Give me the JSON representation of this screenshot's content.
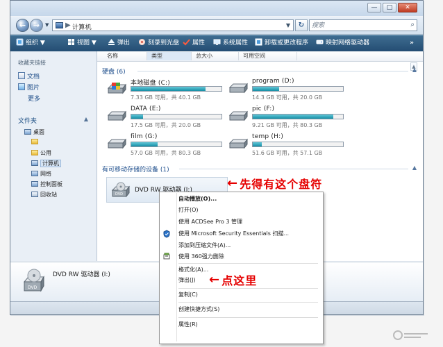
{
  "colors": {
    "toolbar": "#2f5f86",
    "capacity_fill": "#168ea5",
    "annotation": "#e50000",
    "link": "#1e4e8c"
  },
  "window": {
    "controls": {
      "minimize": "—",
      "maximize": "□",
      "close": "✕"
    }
  },
  "address": {
    "path": "计算机",
    "separator": "▶",
    "dropdown": "▼",
    "refresh": "↻"
  },
  "search": {
    "placeholder": "搜索",
    "icon": "search-icon"
  },
  "toolbar": {
    "items": [
      {
        "label": "组织",
        "icon": "organize-icon",
        "dropdown": "▼"
      },
      {
        "label": "视图",
        "icon": "views-icon",
        "dropdown": "▼"
      },
      {
        "label": "弹出",
        "icon": "eject-icon"
      },
      {
        "label": "刻录到光盘",
        "icon": "burn-disc-icon"
      },
      {
        "label": "属性",
        "icon": "properties-icon"
      },
      {
        "label": "系统属性",
        "icon": "system-properties-icon"
      },
      {
        "label": "卸载或更改程序",
        "icon": "uninstall-program-icon"
      },
      {
        "label": "映射网络驱动器",
        "icon": "map-network-drive-icon"
      }
    ],
    "more": "»"
  },
  "sidebar": {
    "favorites_heading": "收藏夹链接",
    "favorites": [
      {
        "label": "文档",
        "icon": "document-icon"
      },
      {
        "label": "图片",
        "icon": "picture-icon"
      },
      {
        "label": "更多",
        "icon": ""
      }
    ],
    "folders_heading": "文件夹",
    "folders_chevron": "▲",
    "tree": [
      {
        "label": "桌面",
        "icon": "desktop-icon"
      },
      {
        "label": "",
        "icon": "user-folder-icon"
      },
      {
        "label": "公用",
        "icon": "public-folder-icon"
      },
      {
        "label": "计算机",
        "icon": "computer-icon"
      },
      {
        "label": "网络",
        "icon": "network-icon"
      },
      {
        "label": "控制面板",
        "icon": "control-panel-icon"
      },
      {
        "label": "回收站",
        "icon": "recycle-bin-icon"
      }
    ]
  },
  "columns": [
    "名称",
    "类型",
    "总大小",
    "可用空间"
  ],
  "groups": {
    "hard_disks": "硬盘 (6)",
    "removable": "有可移动存储的设备 (1)"
  },
  "drives": [
    {
      "name": "本地磁盘 (C:)",
      "free": "7.33 GB 可用，共 40.1 GB",
      "used_fraction": 0.82,
      "icon": "windows-drive-icon"
    },
    {
      "name": "program (D:)",
      "free": "14.3 GB 可用，共 20.0 GB",
      "used_fraction": 0.29,
      "icon": "hard-drive-icon"
    },
    {
      "name": "DATA (E:)",
      "free": "17.5 GB 可用，共 20.0 GB",
      "used_fraction": 0.13,
      "icon": "hard-drive-icon"
    },
    {
      "name": "pic (F:)",
      "free": "9.21 GB 可用，共 80.3 GB",
      "used_fraction": 0.89,
      "icon": "hard-drive-icon"
    },
    {
      "name": "film (G:)",
      "free": "57.0 GB 可用，共 80.3 GB",
      "used_fraction": 0.29,
      "icon": "hard-drive-icon"
    },
    {
      "name": "temp (H:)",
      "free": "51.6 GB 可用，共 57.1 GB",
      "used_fraction": 0.1,
      "icon": "hard-drive-icon"
    }
  ],
  "dvd": {
    "name": "DVD RW 驱动器 (I:)",
    "icon": "dvd-drive-icon",
    "badge": "DVD"
  },
  "context_menu": [
    {
      "label": "自动播放(O)...",
      "bold": true,
      "icon": ""
    },
    {
      "label": "打开(O)",
      "bold": false,
      "icon": ""
    },
    {
      "label": "使用 ACDSee Pro 3 管理",
      "bold": false,
      "icon": ""
    },
    {
      "label": "使用 Microsoft Security Essentials 扫描...",
      "bold": false,
      "icon": "security-essentials-icon"
    },
    {
      "label": "添加到压缩文件(A)...",
      "bold": false,
      "icon": ""
    },
    {
      "label": "使用 360强力删除",
      "bold": false,
      "icon": "delete-tool-icon"
    },
    {
      "separator": true
    },
    {
      "label": "格式化(A)...",
      "bold": false,
      "icon": ""
    },
    {
      "label": "弹出(J)",
      "bold": false,
      "icon": ""
    },
    {
      "separator": true
    },
    {
      "label": "复制(C)",
      "bold": false,
      "icon": ""
    },
    {
      "separator": true
    },
    {
      "label": "创建快捷方式(S)",
      "bold": false,
      "icon": ""
    },
    {
      "separator": true
    },
    {
      "label": "属性(R)",
      "bold": false,
      "icon": ""
    }
  ],
  "annotations": [
    {
      "text": "先得有这个盘符",
      "arrow": "←"
    },
    {
      "text": "点这里",
      "arrow": "←"
    }
  ],
  "details": {
    "name": "DVD RW 驱动器 (I:)",
    "badge": "DVD"
  }
}
